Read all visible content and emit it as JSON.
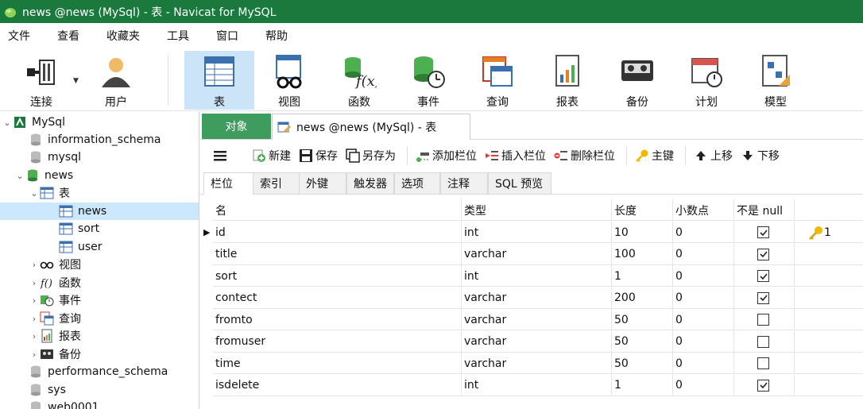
{
  "window": {
    "title": "news @news (MySql) - 表 - Navicat for MySQL"
  },
  "menu": [
    "文件",
    "查看",
    "收藏夹",
    "工具",
    "窗口",
    "帮助"
  ],
  "toolbar": {
    "connect": "连接",
    "user": "用户",
    "table": "表",
    "view": "视图",
    "function": "函数",
    "event": "事件",
    "query": "查询",
    "report": "报表",
    "backup": "备份",
    "schedule": "计划",
    "model": "模型"
  },
  "sidebar": {
    "items": [
      {
        "label": "MySql"
      },
      {
        "label": "information_schema"
      },
      {
        "label": "mysql"
      },
      {
        "label": "news"
      },
      {
        "label": "表"
      },
      {
        "label": "news"
      },
      {
        "label": "sort"
      },
      {
        "label": "user"
      },
      {
        "label": "视图"
      },
      {
        "label": "函数"
      },
      {
        "label": "事件"
      },
      {
        "label": "查询"
      },
      {
        "label": "报表"
      },
      {
        "label": "备份"
      },
      {
        "label": "performance_schema"
      },
      {
        "label": "sys"
      },
      {
        "label": "web0001"
      }
    ]
  },
  "tabs": {
    "objects": "对象",
    "news_tab": "news @news (MySql) - 表"
  },
  "subtoolbar": {
    "new": "新建",
    "save": "保存",
    "save_as": "另存为",
    "add_field": "添加栏位",
    "insert_field": "插入栏位",
    "delete_field": "删除栏位",
    "primary_key": "主键",
    "move_up": "上移",
    "move_down": "下移"
  },
  "subtabs": [
    "栏位",
    "索引",
    "外键",
    "触发器",
    "选项",
    "注释",
    "SQL 预览"
  ],
  "grid": {
    "headers": [
      "名",
      "类型",
      "长度",
      "小数点",
      "不是 null",
      ""
    ],
    "rows": [
      {
        "name": "id",
        "type": "int",
        "length": "10",
        "decimals": "0",
        "not_null": true,
        "key": "1"
      },
      {
        "name": "title",
        "type": "varchar",
        "length": "100",
        "decimals": "0",
        "not_null": true,
        "key": ""
      },
      {
        "name": "sort",
        "type": "int",
        "length": "1",
        "decimals": "0",
        "not_null": true,
        "key": ""
      },
      {
        "name": "contect",
        "type": "varchar",
        "length": "200",
        "decimals": "0",
        "not_null": true,
        "key": ""
      },
      {
        "name": "fromto",
        "type": "varchar",
        "length": "50",
        "decimals": "0",
        "not_null": false,
        "key": ""
      },
      {
        "name": "fromuser",
        "type": "varchar",
        "length": "50",
        "decimals": "0",
        "not_null": false,
        "key": ""
      },
      {
        "name": "time",
        "type": "varchar",
        "length": "50",
        "decimals": "0",
        "not_null": false,
        "key": ""
      },
      {
        "name": "isdelete",
        "type": "int",
        "length": "1",
        "decimals": "0",
        "not_null": true,
        "key": ""
      }
    ]
  },
  "colors": {
    "titlebar": "#1a7a3e",
    "tab_active": "#3f9c5f",
    "selection": "#cce8ff",
    "toolbar_active": "#cce4f7"
  }
}
